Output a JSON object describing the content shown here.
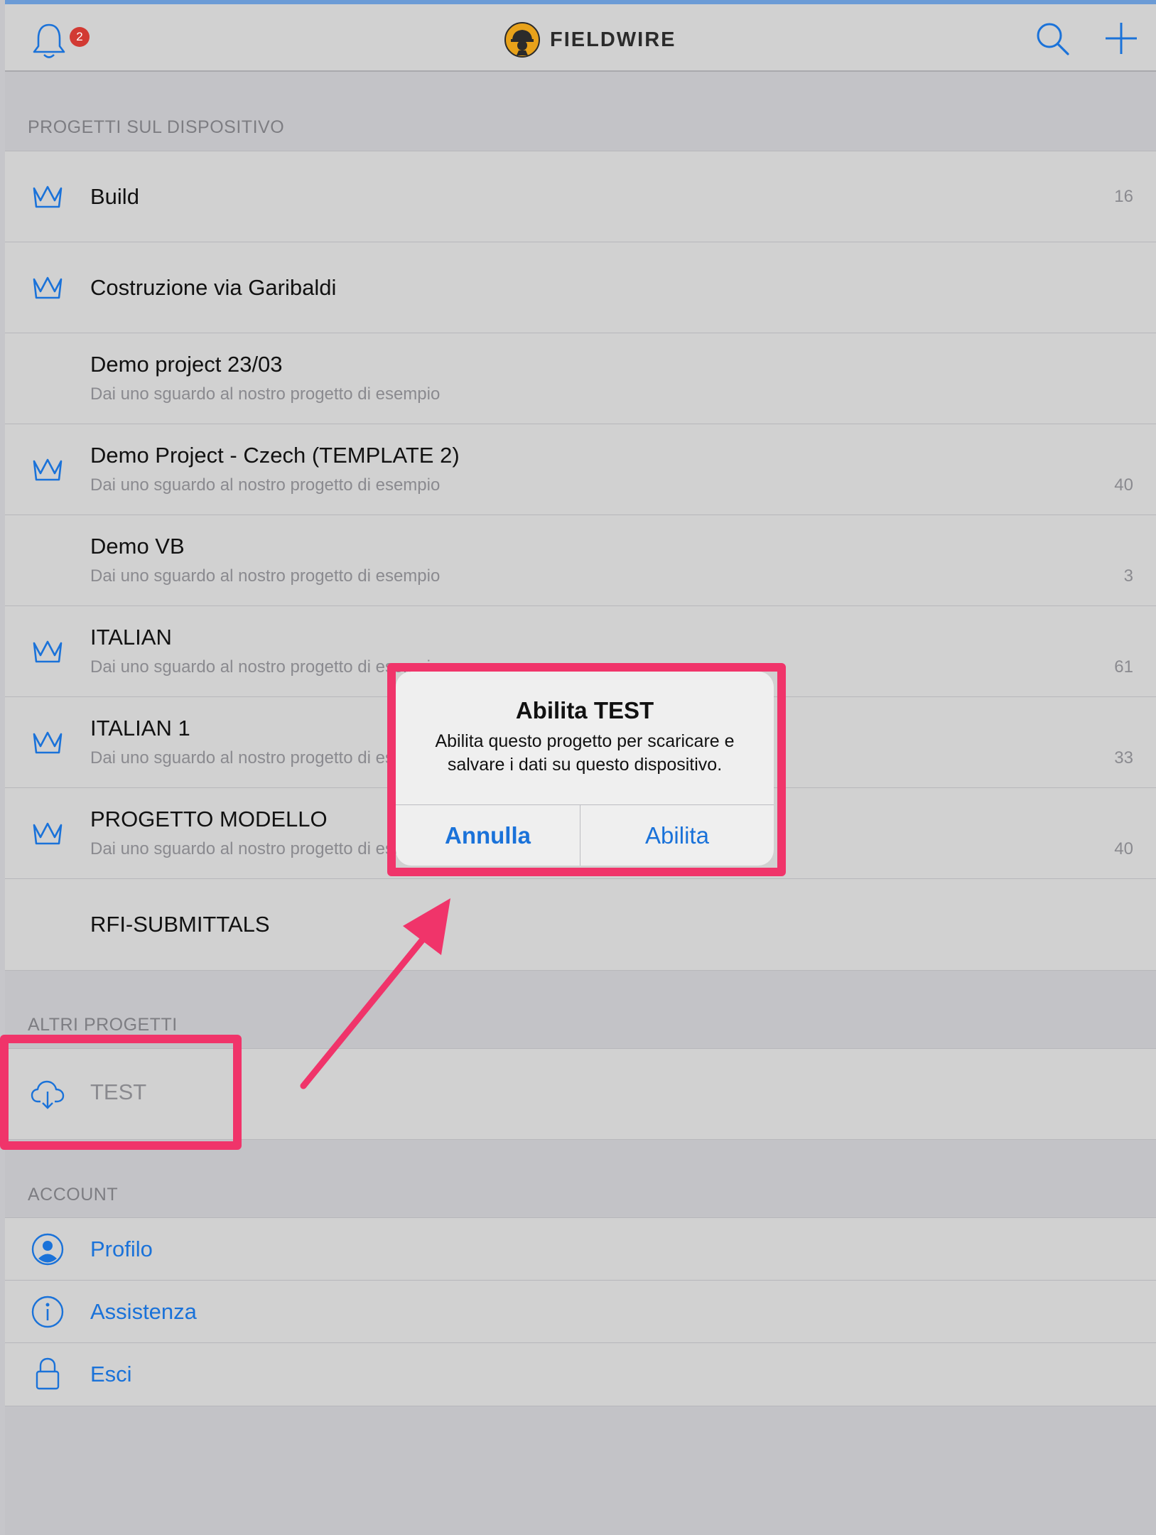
{
  "header": {
    "notification_count": "2",
    "brand": "FIELDWIRE"
  },
  "sections": {
    "device": "PROGETTI SUL DISPOSITIVO",
    "others": "ALTRI PROGETTI",
    "account": "ACCOUNT"
  },
  "projects": [
    {
      "title": "Build",
      "subtitle": "",
      "count": "16",
      "icon": "crown-icon"
    },
    {
      "title": "Costruzione via Garibaldi",
      "subtitle": "",
      "count": "",
      "icon": "crown-icon"
    },
    {
      "title": "Demo project  23/03",
      "subtitle": "Dai uno sguardo al nostro progetto di esempio",
      "count": "",
      "icon": ""
    },
    {
      "title": "Demo Project - Czech (TEMPLATE 2)",
      "subtitle": "Dai uno sguardo al nostro progetto di esempio",
      "count": "40",
      "icon": "crown-icon"
    },
    {
      "title": "Demo VB",
      "subtitle": "Dai uno sguardo al nostro progetto di esempio",
      "count": "3",
      "icon": ""
    },
    {
      "title": "ITALIAN",
      "subtitle": "Dai uno sguardo al nostro progetto di esempio",
      "count": "61",
      "icon": "crown-icon"
    },
    {
      "title": "ITALIAN 1",
      "subtitle": "Dai uno sguardo al nostro progetto di esempio",
      "count": "33",
      "icon": "crown-icon"
    },
    {
      "title": "PROGETTO MODELLO",
      "subtitle": "Dai uno sguardo al nostro progetto di esempio",
      "count": "40",
      "icon": "crown-icon"
    },
    {
      "title": "RFI-SUBMITTALS",
      "subtitle": "",
      "count": "",
      "icon": ""
    }
  ],
  "other_projects": [
    {
      "title": "TEST",
      "icon": "cloud-download-icon"
    }
  ],
  "account": [
    {
      "title": "Profilo",
      "icon": "profile-icon"
    },
    {
      "title": "Assistenza",
      "icon": "info-icon"
    },
    {
      "title": "Esci",
      "icon": "lock-icon"
    }
  ],
  "dialog": {
    "title": "Abilita TEST",
    "message_line1": "Abilita questo progetto per scaricare e",
    "message_line2": "salvare i dati su questo dispositivo.",
    "cancel": "Annulla",
    "confirm": "Abilita"
  },
  "colors": {
    "accent": "#1a72d9",
    "highlight": "#f0346a",
    "badge": "#d23a33"
  }
}
